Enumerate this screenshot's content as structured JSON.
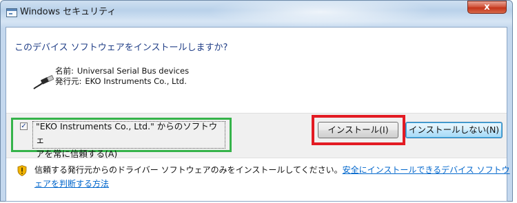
{
  "window": {
    "title": "Windows セキュリティ",
    "close_label": "x"
  },
  "dialog": {
    "question": "このデバイス ソフトウェアをインストールしますか?",
    "device": {
      "name_label": "名前:",
      "name_value": "Universal Serial Bus devices",
      "publisher_label": "発行元:",
      "publisher_value": "EKO Instruments Co., Ltd.",
      "icon": "usb-plug-icon"
    },
    "trust_checkbox": {
      "checked": true,
      "check_mark": "✓",
      "label_line1": "\"EKO Instruments Co., Ltd.\" からのソフトウェ",
      "label_line2": "アを常に信頼する(A)"
    },
    "buttons": {
      "install": "インストール(I)",
      "dont_install": "インストールしない(N)"
    },
    "footer": {
      "icon": "shield-warning-icon",
      "text": "信頼する発行元からのドライバー ソフトウェアのみをインストールしてください。",
      "link": "安全にインストールできるデバイス ソフトウェアを判断する方法"
    }
  },
  "annotations": {
    "green_highlight_color": "#35b34a",
    "red_highlight_color": "#e31b23"
  }
}
